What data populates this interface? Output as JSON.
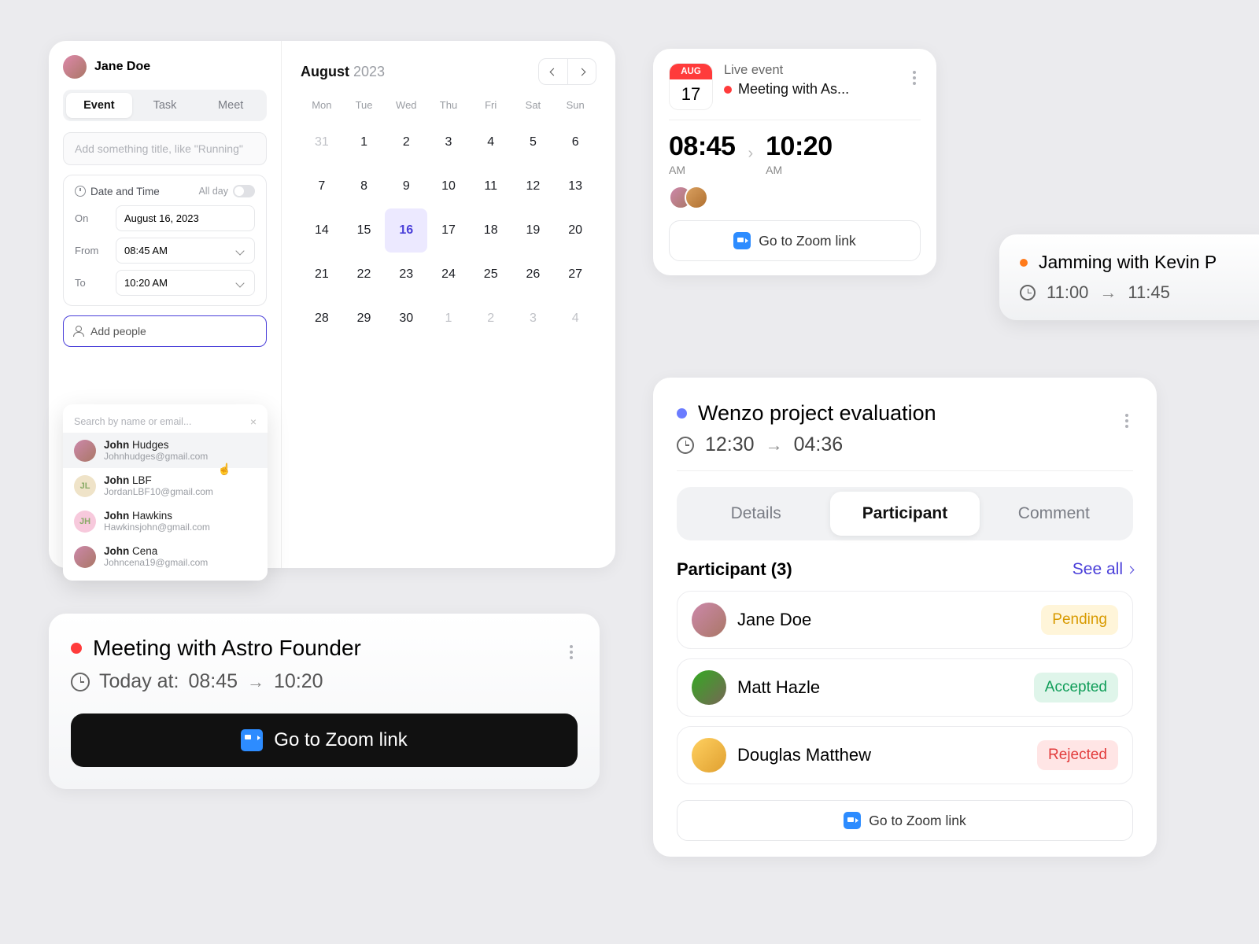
{
  "creator": {
    "user_name": "Jane Doe",
    "tabs": [
      "Event",
      "Task",
      "Meet"
    ],
    "active_tab": 0,
    "title_placeholder": "Add something title, like \"Running\"",
    "dt": {
      "label": "Date and Time",
      "allday_label": "All day",
      "on_label": "On",
      "from_label": "From",
      "to_label": "To",
      "on_value": "August 16, 2023",
      "from_value": "08:45 AM",
      "to_value": "10:20 AM"
    },
    "add_people_label": "Add people",
    "search_placeholder": "Search by name or email...",
    "suggestions": [
      {
        "first": "John",
        "last": "Hudges",
        "email": "Johnhudges@gmail.com",
        "initials": "",
        "hover": true
      },
      {
        "first": "John",
        "last": "LBF",
        "email": "JordanLBF10@gmail.com",
        "initials": "JL",
        "hover": false
      },
      {
        "first": "John",
        "last": "Hawkins",
        "email": "Hawkinsjohn@gmail.com",
        "initials": "JH",
        "hover": false
      },
      {
        "first": "John",
        "last": "Cena",
        "email": "Johncena19@gmail.com",
        "initials": "",
        "hover": false
      }
    ]
  },
  "calendar": {
    "month": "August",
    "year": "2023",
    "dows": [
      "Mon",
      "Tue",
      "Wed",
      "Thu",
      "Fri",
      "Sat",
      "Sun"
    ],
    "weeks": [
      [
        {
          "d": "31",
          "dim": true
        },
        {
          "d": "1"
        },
        {
          "d": "2"
        },
        {
          "d": "3"
        },
        {
          "d": "4"
        },
        {
          "d": "5"
        },
        {
          "d": "6"
        }
      ],
      [
        {
          "d": "7"
        },
        {
          "d": "8"
        },
        {
          "d": "9"
        },
        {
          "d": "10"
        },
        {
          "d": "11"
        },
        {
          "d": "12"
        },
        {
          "d": "13"
        }
      ],
      [
        {
          "d": "14"
        },
        {
          "d": "15"
        },
        {
          "d": "16",
          "sel": true
        },
        {
          "d": "17"
        },
        {
          "d": "18"
        },
        {
          "d": "19"
        },
        {
          "d": "20"
        }
      ],
      [
        {
          "d": "21"
        },
        {
          "d": "22"
        },
        {
          "d": "23"
        },
        {
          "d": "24"
        },
        {
          "d": "25"
        },
        {
          "d": "26"
        },
        {
          "d": "27"
        }
      ],
      [
        {
          "d": "28"
        },
        {
          "d": "29"
        },
        {
          "d": "30"
        },
        {
          "d": "1",
          "dim": true
        },
        {
          "d": "2",
          "dim": true
        },
        {
          "d": "3",
          "dim": true
        },
        {
          "d": "4",
          "dim": true
        }
      ]
    ]
  },
  "live_event": {
    "badge_month": "AUG",
    "badge_day": "17",
    "label": "Live event",
    "title": "Meeting with As...",
    "start_big": "08:45",
    "start_am": "AM",
    "end_big": "10:20",
    "end_am": "AM",
    "zoom_label": "Go to Zoom link"
  },
  "jam": {
    "title": "Jamming with Kevin P",
    "start": "11:00",
    "end": "11:45"
  },
  "meeting": {
    "title": "Meeting with Astro Founder",
    "time_pre": "Today at:",
    "start": "08:45",
    "end": "10:20",
    "zoom_label": "Go to Zoom link"
  },
  "wenzo": {
    "title": "Wenzo project evaluation",
    "start": "12:30",
    "end": "04:36",
    "segments": [
      "Details",
      "Participant",
      "Comment"
    ],
    "active_segment": 1,
    "participants_header": "Participant (3)",
    "see_all": "See all",
    "participants": [
      {
        "name": "Jane Doe",
        "status": "Pending",
        "statusClass": "pending"
      },
      {
        "name": "Matt Hazle",
        "status": "Accepted",
        "statusClass": "accepted"
      },
      {
        "name": "Douglas Matthew",
        "status": "Rejected",
        "statusClass": "rejected"
      }
    ],
    "zoom_label": "Go to Zoom link"
  }
}
